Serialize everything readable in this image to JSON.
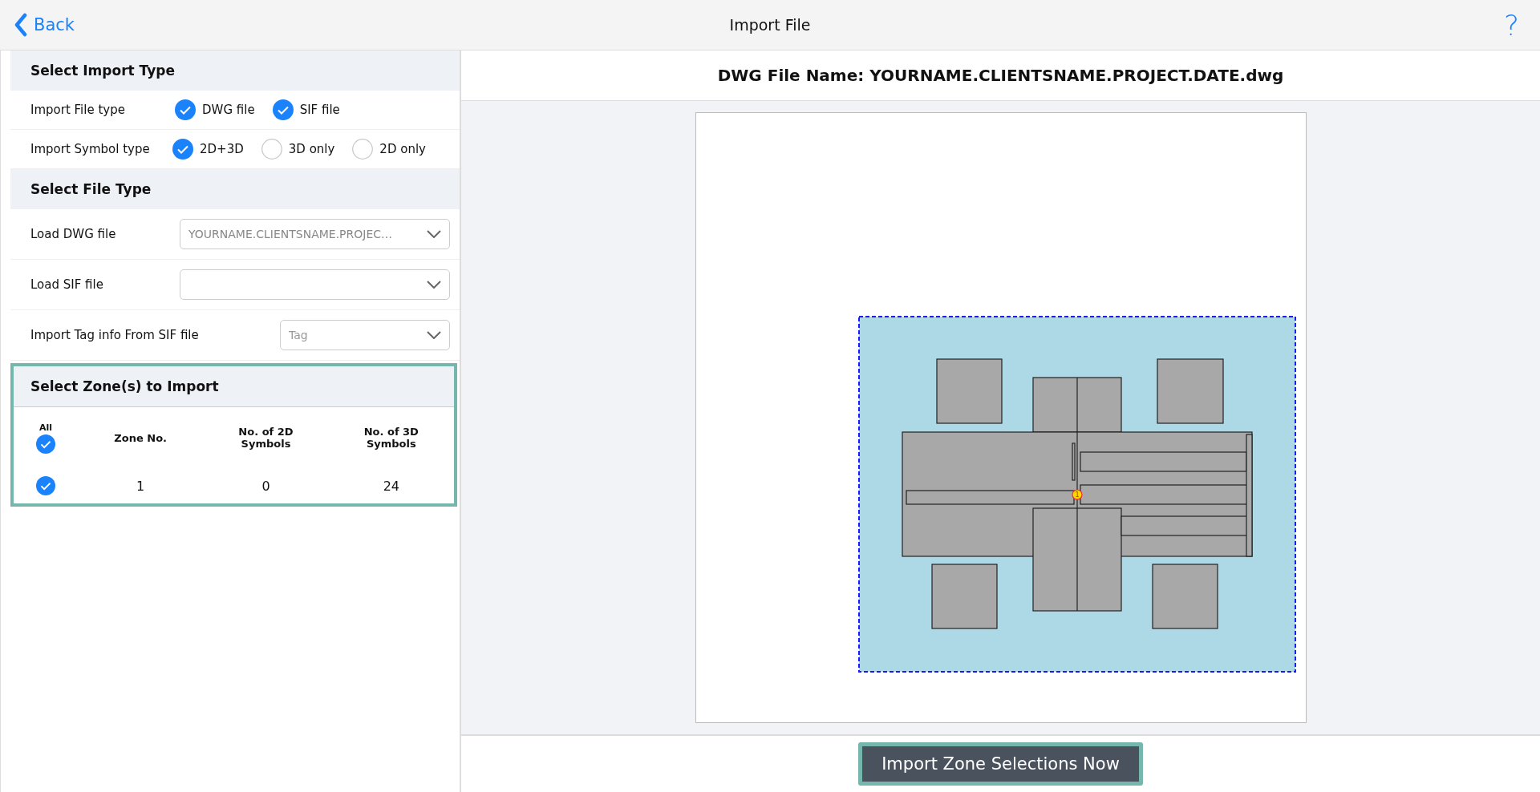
{
  "header": {
    "back": "Back",
    "title": "Import File",
    "help": "?"
  },
  "import_type": {
    "title": "Select Import Type",
    "rows": [
      {
        "label": "Import File type",
        "options": [
          {
            "label": "DWG file",
            "checked": true
          },
          {
            "label": "SIF file",
            "checked": true
          }
        ]
      },
      {
        "label": "Import Symbol type",
        "options": [
          {
            "label": "2D+3D",
            "selected": true
          },
          {
            "label": "3D only",
            "selected": false
          },
          {
            "label": "2D only",
            "selected": false
          }
        ]
      }
    ]
  },
  "file_type": {
    "title": "Select File Type",
    "fields": [
      {
        "kind": "wide",
        "label": "Load DWG file",
        "value": "YOURNAME.CLIENTSNAME.PROJEC…"
      },
      {
        "kind": "wide",
        "label": "Load SIF file"
      },
      {
        "kind": "narrow",
        "label": "Import Tag info From SIF file",
        "placeholder": "Tag"
      }
    ]
  },
  "zones": {
    "title": "Select Zone(s) to Import",
    "all_label": "All",
    "all_checked": true,
    "columns": [
      "Zone No.",
      "No. of 2D Symbols",
      "No. of 3D Symbols"
    ],
    "rows": [
      {
        "checked": true,
        "cells": [
          "1",
          "0",
          "24"
        ]
      }
    ]
  },
  "preview": {
    "title": "DWG File Name: YOURNAME.CLIENTSNAME.PROJECT.DATE.dwg",
    "marker": "1"
  },
  "import_button": "Import Zone Selections Now"
}
